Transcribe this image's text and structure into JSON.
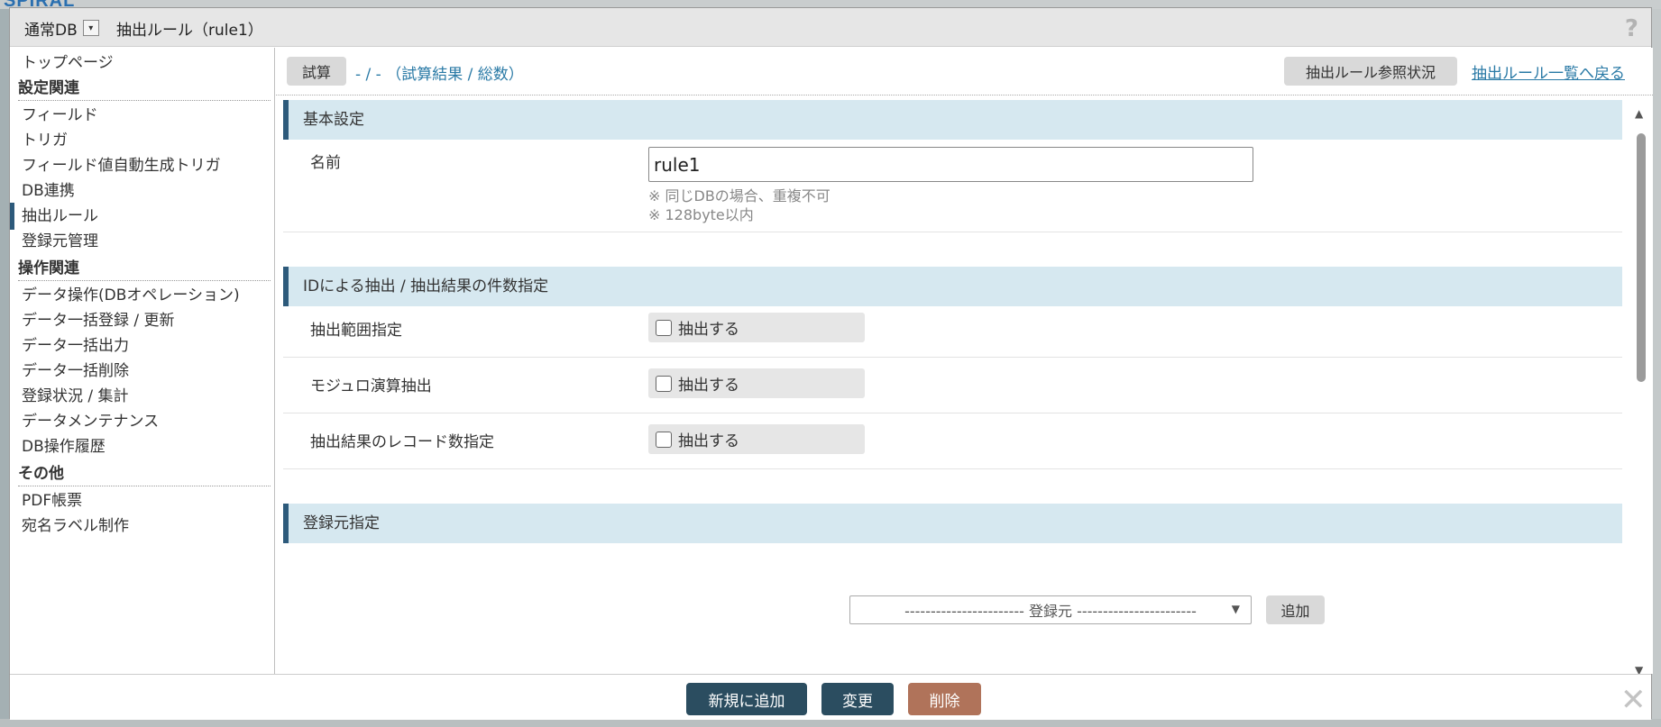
{
  "background": {
    "logo_text": "SPIRAL"
  },
  "titlebar": {
    "db_label": "通常DB",
    "dropdown_glyph": "▾",
    "title": "抽出ルール（rule1）",
    "help_glyph": "?"
  },
  "sidebar": {
    "top_page": "トップページ",
    "group_settings": "設定関連",
    "items_settings": [
      "フィールド",
      "トリガ",
      "フィールド値自動生成トリガ",
      "DB連携",
      "抽出ルール",
      "登録元管理"
    ],
    "group_operations": "操作関連",
    "items_operations": [
      "データ操作(DBオペレーション)",
      "データ一括登録 / 更新",
      "データ一括出力",
      "データ一括削除",
      "登録状況 / 集計",
      "データメンテナンス",
      "DB操作履歴"
    ],
    "group_other": "その他",
    "items_other": [
      "PDF帳票",
      "宛名ラベル制作"
    ]
  },
  "toolbar": {
    "trial_label": "試算",
    "trial_status": "- / - （試算結果 / 総数）",
    "ref_label": "抽出ルール参照状況",
    "back_link": "抽出ルール一覧へ戻る"
  },
  "basic": {
    "heading": "基本設定",
    "name_label": "名前",
    "name_value": "rule1",
    "note1": "※ 同じDBの場合、重複不可",
    "note2": "※ 128byte以内"
  },
  "id_extract": {
    "heading": "IDによる抽出 / 抽出結果の件数指定",
    "rows": [
      {
        "label": "抽出範囲指定",
        "checkbox_label": "抽出する",
        "checked": false
      },
      {
        "label": "モジュロ演算抽出",
        "checkbox_label": "抽出する",
        "checked": false
      },
      {
        "label": "抽出結果のレコード数指定",
        "checkbox_label": "抽出する",
        "checked": false
      }
    ]
  },
  "source": {
    "heading": "登録元指定",
    "select_value": "----------------------- 登録元 -----------------------",
    "select_caret": "▼",
    "add_label": "追加"
  },
  "scrollbar": {
    "up_glyph": "▲",
    "down_glyph": "▼"
  },
  "footer": {
    "new_label": "新規に追加",
    "edit_label": "変更",
    "delete_label": "削除",
    "close_glyph": "✕"
  },
  "colors": {
    "accent_dark": "#2b4d60",
    "delete": "#b0735a",
    "section_bg": "#d6e8f0",
    "link": "#2a7aa6"
  }
}
